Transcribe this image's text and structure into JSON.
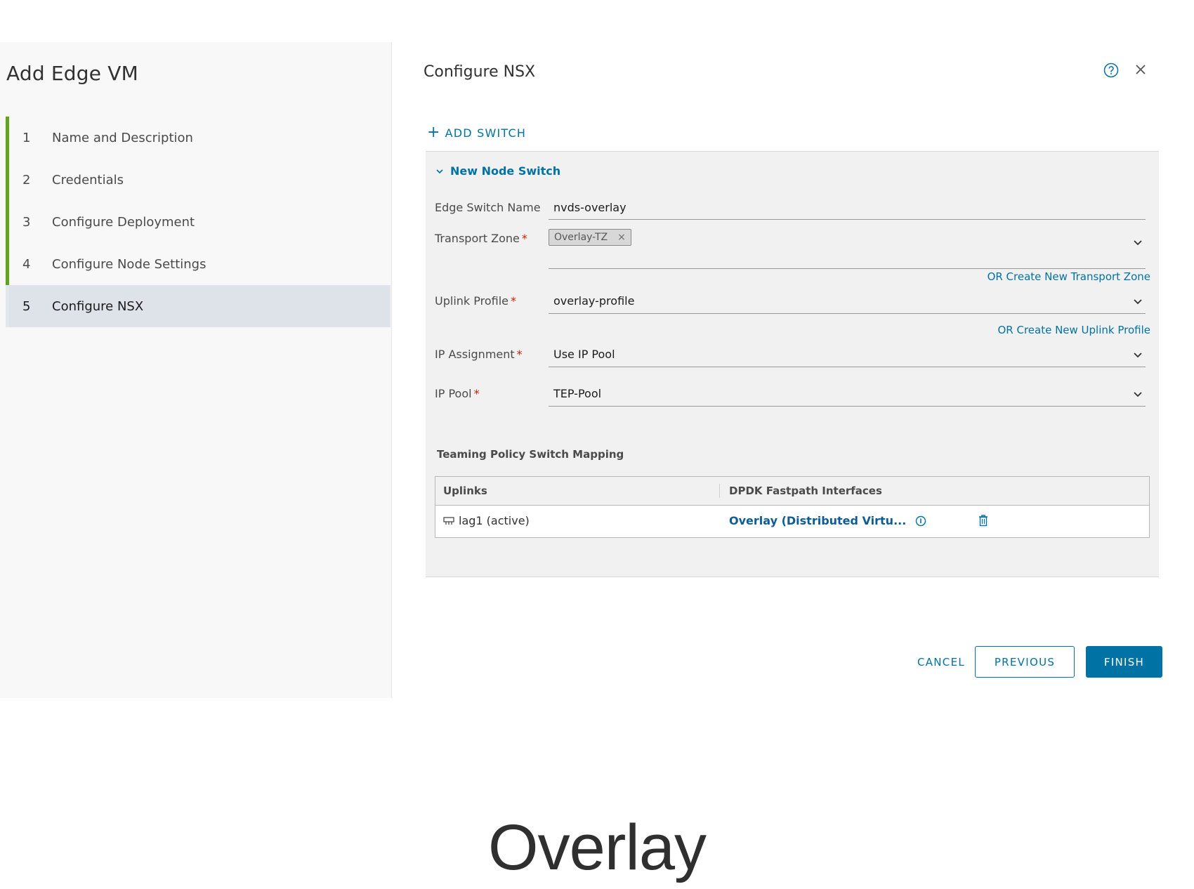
{
  "wizard": {
    "title": "Add Edge VM",
    "steps": [
      {
        "num": "1",
        "label": "Name and Description"
      },
      {
        "num": "2",
        "label": "Credentials"
      },
      {
        "num": "3",
        "label": "Configure Deployment"
      },
      {
        "num": "4",
        "label": "Configure Node Settings"
      },
      {
        "num": "5",
        "label": "Configure NSX"
      }
    ],
    "active_step": "5"
  },
  "main": {
    "title": "Configure NSX",
    "add_switch_label": "ADD SWITCH",
    "switch": {
      "header": "New Node Switch",
      "edge_switch_name": {
        "label": "Edge Switch Name",
        "value": "nvds-overlay"
      },
      "transport_zone": {
        "label": "Transport Zone",
        "tag": "Overlay-TZ",
        "link": "OR Create New Transport Zone"
      },
      "uplink_profile": {
        "label": "Uplink Profile",
        "value": "overlay-profile",
        "link": "OR Create New Uplink Profile"
      },
      "ip_assignment": {
        "label": "IP Assignment",
        "value": "Use IP Pool"
      },
      "ip_pool": {
        "label": "IP Pool",
        "value": "TEP-Pool"
      },
      "mapping": {
        "title": "Teaming Policy Switch Mapping",
        "columns": [
          "Uplinks",
          "DPDK Fastpath Interfaces"
        ],
        "rows": [
          {
            "uplink": "lag1 (active)",
            "interface": "Overlay (Distributed Virtu..."
          }
        ]
      }
    }
  },
  "buttons": {
    "cancel": "CANCEL",
    "previous": "PREVIOUS",
    "finish": "FINISH"
  },
  "caption": "Overlay",
  "colors": {
    "accent": "#0072a3",
    "step_bar": "#62a420",
    "required": "#c92100"
  }
}
